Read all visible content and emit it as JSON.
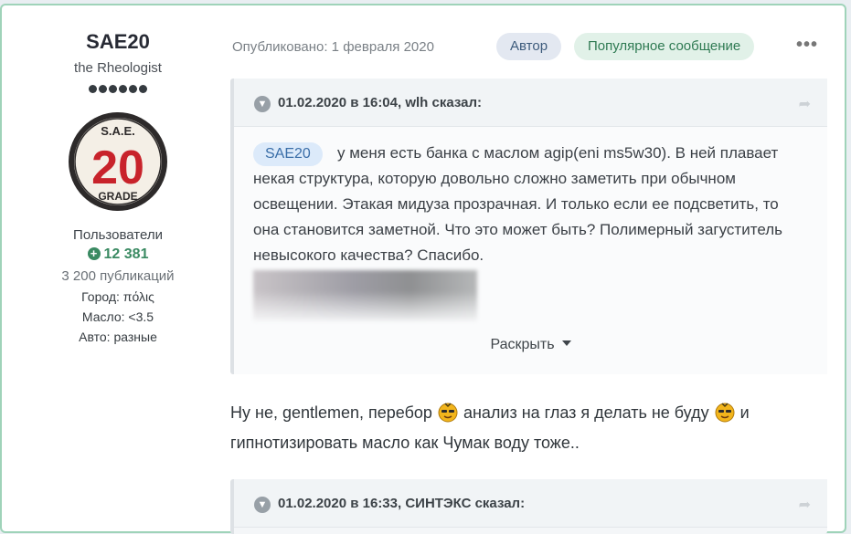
{
  "author": {
    "name": "SAE20",
    "title": "the Rheologist",
    "rank_pips": 6,
    "avatar": {
      "top_text": "S.A.E.",
      "number": "20",
      "bottom_text": "GRADE",
      "accent": "#c8232b"
    },
    "group": "Пользователи",
    "reputation": "12 381",
    "posts": "3 200 публикаций",
    "fields": [
      {
        "label": "Город:",
        "value": "πόλις"
      },
      {
        "label": "Масло:",
        "value": "<3.5"
      },
      {
        "label": "Авто:",
        "value": "разные"
      }
    ]
  },
  "post": {
    "published": "Опубликовано: 1 февраля 2020",
    "badge_author": "Автор",
    "badge_popular": "Популярное сообщение",
    "more_icon": "ellipsis-icon",
    "quote1": {
      "header": "01.02.2020 в 16:04, wlh сказал:",
      "mention": "SAE20",
      "text": "у меня есть банка с маслом agip(eni ms5w30). В ней плавает некая структура, которую довольно сложно заметить при обычном освещении. Этакая мидуза прозрачная. И только если ее подсветить, то она становится заметной. Что это может быть? Полимерный загуститель невысокого качества? Спасибо.",
      "expand_label": "Раскрыть"
    },
    "text_part1": "Ну не, gentlemen, перебор",
    "text_part2": "анализ на глаз я делать не буду",
    "text_part3": "и гипнотизировать масло как Чумак воду тоже..",
    "quote2": {
      "header": "01.02.2020 в 16:33, СИНТЭКС сказал:"
    }
  },
  "colors": {
    "accent_green": "#3a8a62",
    "card_border": "#9fd3b9"
  }
}
